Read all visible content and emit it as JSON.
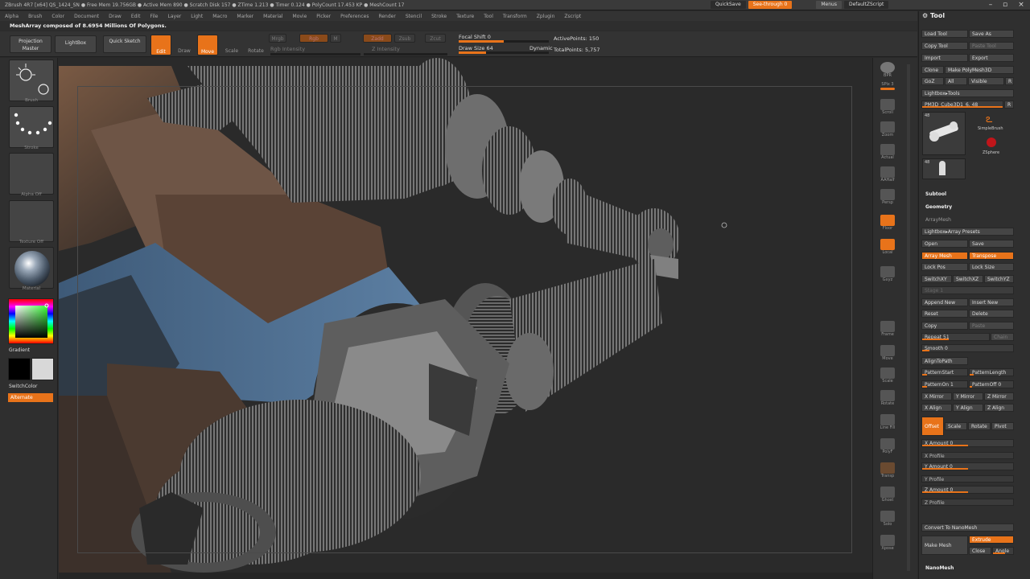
{
  "titlebar": {
    "text": "ZBrush 4R7 [x64]   QS_1424_SN   ● Free Mem 19.756GB ● Active Mem 890 ● Scratch Disk 157 ● ZTime 1.213 ● Timer 0.124 ● PolyCount 17.453 KP ● MeshCount 17",
    "quicksave": "QuickSave",
    "seethrough": "See-through 0",
    "menus": "Menus",
    "script": "DefaultZScript"
  },
  "menubar": {
    "items": [
      "Alpha",
      "Brush",
      "Color",
      "Document",
      "Draw",
      "Edit",
      "File",
      "Layer",
      "Light",
      "Macro",
      "Marker",
      "Material",
      "Movie",
      "Picker",
      "Preferences",
      "Render",
      "Stencil",
      "Stroke",
      "Texture",
      "Tool",
      "Transform",
      "Zplugin",
      "Zscript"
    ]
  },
  "status": "MeshArray composed of 8.6954 Millions Of Polygons.",
  "toolbar": {
    "projection_master": "Projection Master",
    "lightbox": "LightBox",
    "quick_sketch": "Quick Sketch",
    "edit": "Edit",
    "draw": "Draw",
    "move": "Move",
    "scale": "Scale",
    "rotate": "Rotate",
    "mrgb": "Mrgb",
    "rgb": "Rgb",
    "m": "M",
    "rgb_intensity": "Rgb Intensity",
    "zadd": "Zadd",
    "zsub": "Zsub",
    "zcut": "Zcut",
    "z_intensity": "Z Intensity",
    "focal_shift": "Focal Shift 0",
    "draw_size": "Draw Size 64",
    "dynamic": "Dynamic",
    "active_points": "ActivePoints: 150",
    "total_points": "TotalPoints: 5,757"
  },
  "left_shelf": {
    "slots": [
      "Brush",
      "Stroke",
      "Alpha Off",
      "Texture Off",
      "Material"
    ],
    "gradient": "Gradient",
    "switch_color": "SwitchColor",
    "alternate": "Alternate"
  },
  "right_shelf": {
    "buttons": [
      "BPR",
      "SPix 3",
      "Scroll",
      "Zoom",
      "Actual",
      "AAHalf",
      "Persp",
      "Floor",
      "Local",
      "Gxyz",
      "Frame",
      "Move",
      "Scale",
      "Rotate",
      "Line Fill",
      "PolyF",
      "Transp",
      "Ghost",
      "Solo",
      "Xpose"
    ]
  },
  "tool_panel": {
    "title": "Tool",
    "load_tool": "Load Tool",
    "save_as": "Save As",
    "copy_tool": "Copy Tool",
    "paste_tool": "Paste Tool",
    "import": "Import",
    "export": "Export",
    "clone": "Clone",
    "make_polymesh": "Make PolyMesh3D",
    "goz": "GoZ",
    "all": "All",
    "visible": "Visible",
    "r": "R",
    "lightbox_tools": "Lightbox▸Tools",
    "current_tool": "PM3D_Cube3D1_6. 48",
    "tool_count": "R",
    "simplebrush": "SimpleBrush",
    "zsphere": "ZSphere",
    "thumb1_num": "48",
    "thumb2_num": "48",
    "subtool": "Subtool",
    "geometry": "Geometry",
    "arraymesh": "ArrayMesh",
    "arraymesh_presets": "Lightbox▸Array Presets",
    "open": "Open",
    "save": "Save",
    "array_mesh": "Array Mesh",
    "transpose": "Transpose",
    "lock_pos": "Lock Pos",
    "lock_size": "Lock Size",
    "switch_xy": "SwitchXY",
    "switch_xz": "SwitchXZ",
    "switch_yz": "SwitchYZ",
    "stage": "Stage 1",
    "append_new": "Append New",
    "insert_new": "Insert New",
    "reset": "Reset",
    "delete": "Delete",
    "copy": "Copy",
    "paste": "Paste",
    "repeat": "Repeat 51",
    "instance": "Chain",
    "smooth": "Smooth 0",
    "align_to_path": "AlignToPath",
    "pattern_start": "PatternStart",
    "pattern_length": "PatternLength",
    "pattern_on": "PatternOn 1",
    "pattern_off": "PatternOff 0",
    "x_mirror": "X Mirror",
    "y_mirror": "Y Mirror",
    "z_mirror": "Z Mirror",
    "x_align": "X Align",
    "y_align": "Y Align",
    "z_align": "Z Align",
    "offset": "Offset",
    "scale": "Scale",
    "rotate": "Rotate",
    "pivot": "Pivot",
    "x_amount": "X Amount 0",
    "x_profile": "X Profile",
    "y_amount": "Y Amount 0",
    "y_profile": "Y Profile",
    "z_amount": "Z Amount 0",
    "z_profile": "Z Profile",
    "convert_nanomesh": "Convert To NanoMesh",
    "make_mesh": "Make Mesh",
    "extrude": "Extrude",
    "close": "Close",
    "angle": "Angle",
    "nanomesh": "NanoMesh"
  },
  "colors": {
    "accent": "#e8731a",
    "panel": "#2f2f2f",
    "viewport": "#2a2a2a"
  }
}
